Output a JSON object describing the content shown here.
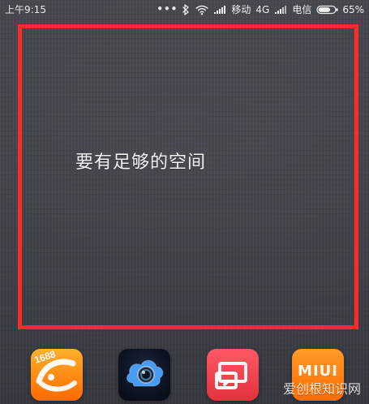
{
  "status_bar": {
    "time": "上午9:15",
    "dots": "•••",
    "carrier_1": "移动",
    "network_1": "4G",
    "carrier_2": "电信",
    "battery_percent": "65%"
  },
  "highlight": {
    "caption": "要有足够的空间",
    "border_color": "#ff2b2b"
  },
  "dock": {
    "apps": [
      {
        "name": "1688",
        "label": "1688"
      },
      {
        "name": "camera",
        "label": ""
      },
      {
        "name": "cast",
        "label": ""
      },
      {
        "name": "miui",
        "label": "MIUI"
      }
    ]
  },
  "watermark": {
    "text": "爱创根知识网"
  }
}
